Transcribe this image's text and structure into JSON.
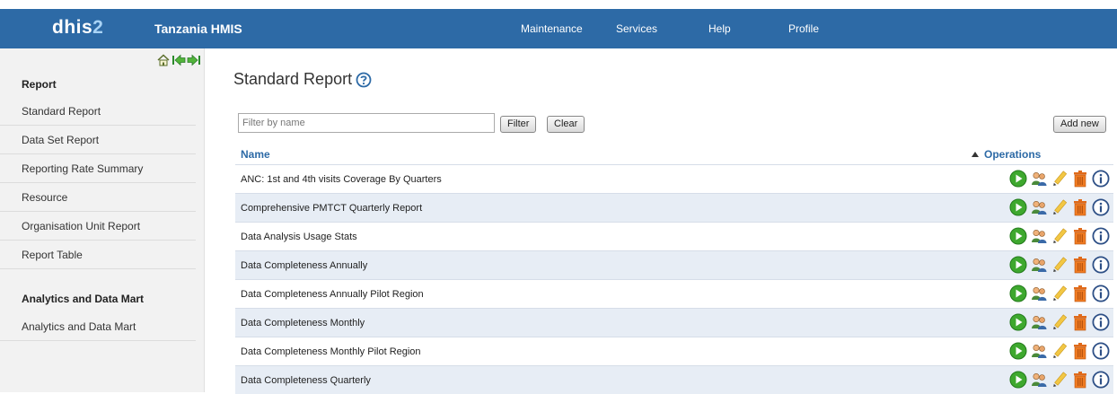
{
  "header": {
    "logo_main": "dhis",
    "logo_num": "2",
    "app_name": "Tanzania HMIS",
    "menu": [
      "Maintenance",
      "Services",
      "Help",
      "Profile"
    ]
  },
  "sidebar": {
    "section1": "Report",
    "items1": [
      "Standard Report",
      "Data Set Report",
      "Reporting Rate Summary",
      "Resource",
      "Organisation Unit Report",
      "Report Table"
    ],
    "section2": "Analytics and Data Mart",
    "items2": [
      "Analytics and Data Mart"
    ]
  },
  "page": {
    "title": "Standard Report",
    "filter_placeholder": "Filter by name",
    "filter_button": "Filter",
    "clear_button": "Clear",
    "add_new_button": "Add new"
  },
  "table": {
    "col_name": "Name",
    "col_operations": "Operations",
    "sort_direction": "ascending",
    "rows": [
      "ANC: 1st and 4th visits Coverage By Quarters",
      "Comprehensive PMTCT Quarterly Report",
      "Data Analysis Usage Stats",
      "Data Completeness Annually",
      "Data Completeness Annually Pilot Region",
      "Data Completeness Monthly",
      "Data Completeness Monthly Pilot Region",
      "Data Completeness Quarterly"
    ],
    "operation_icons": [
      "run-report-icon",
      "sharing-icon",
      "edit-icon",
      "delete-icon",
      "info-icon"
    ]
  },
  "colors": {
    "topbar": "#2d6aa6",
    "row_alt": "#e7edf5",
    "header_text": "#2d6aa6"
  }
}
